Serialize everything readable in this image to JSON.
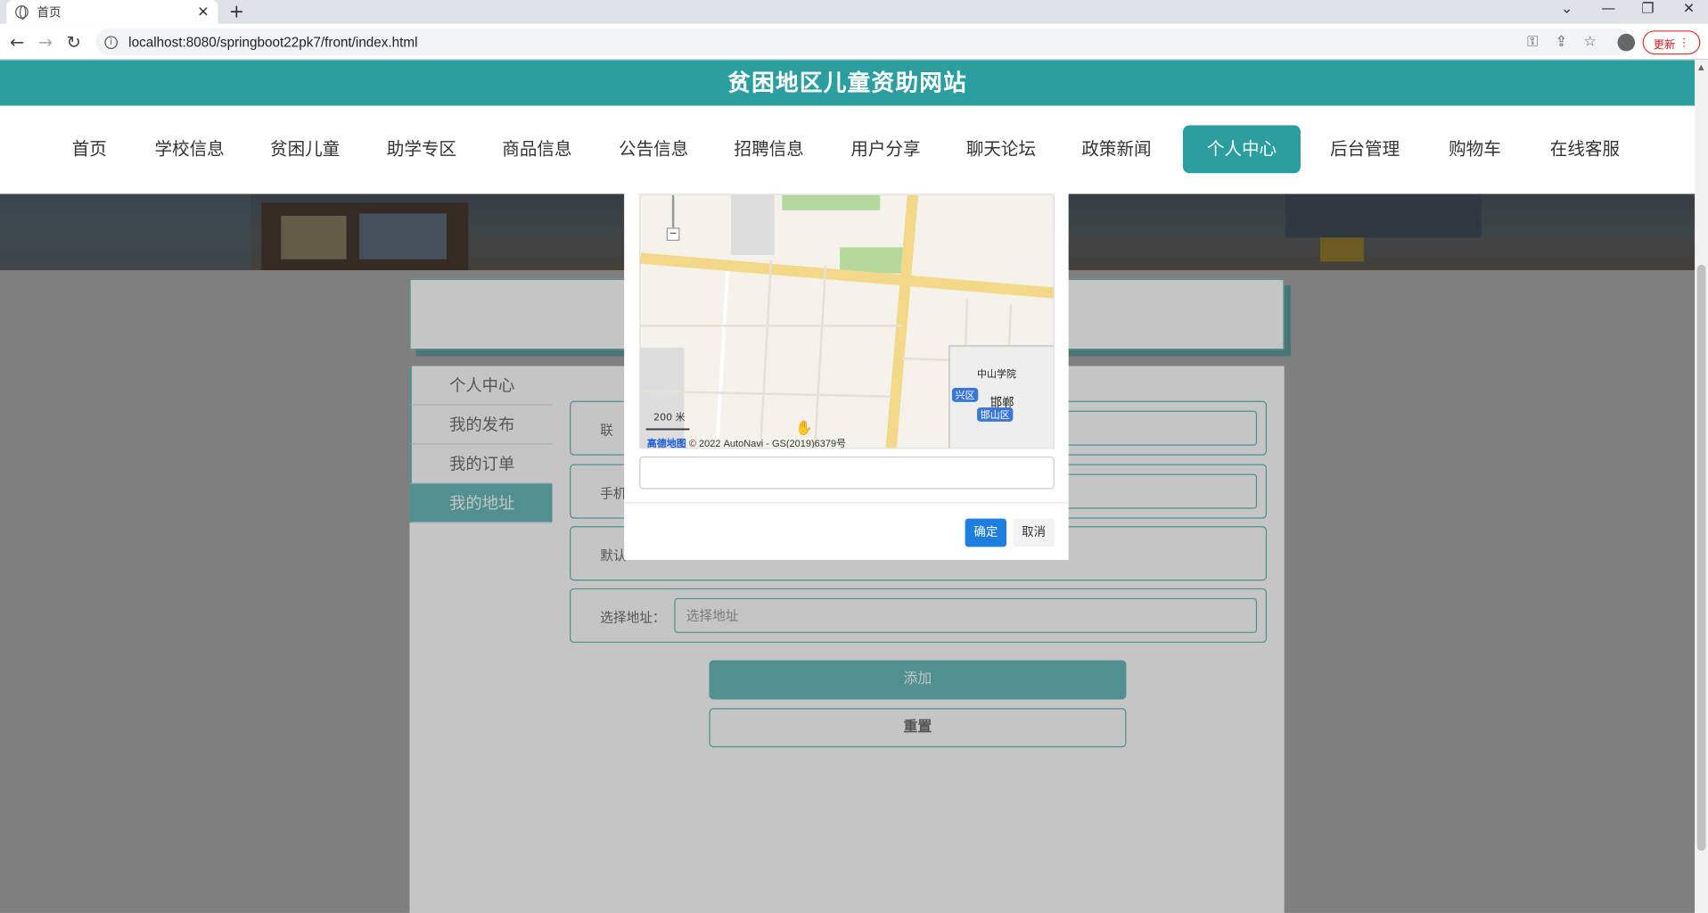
{
  "browser": {
    "tab_title": "首页",
    "url": "localhost:8080/springboot22pk7/front/index.html",
    "update_label": "更新"
  },
  "site": {
    "title": "贫困地区儿童资助网站"
  },
  "nav": {
    "items": [
      "首页",
      "学校信息",
      "贫困儿童",
      "助学专区",
      "商品信息",
      "公告信息",
      "招聘信息",
      "用户分享",
      "聊天论坛",
      "政策新闻",
      "个人中心",
      "后台管理",
      "购物车",
      "在线客服"
    ],
    "active": "个人中心"
  },
  "sidebar": {
    "items": [
      "个人中心",
      "我的发布",
      "我的订单",
      "我的地址"
    ],
    "active": "我的地址"
  },
  "form": {
    "fields": [
      {
        "label": "联",
        "value": ""
      },
      {
        "label": "手机",
        "value": ""
      },
      {
        "label": "默认",
        "value": ""
      },
      {
        "label": "选择地址：",
        "value": "",
        "placeholder": "选择地址"
      }
    ],
    "add_label": "添加",
    "reset_label": "重置"
  },
  "modal": {
    "map": {
      "scale_label": "200 米",
      "provider": "高德地图",
      "copyright": "© 2022 AutoNavi - GS(2019)6379号",
      "minimap_labels": [
        "中山学院",
        "邯郸",
        "兴区",
        "邯山区"
      ]
    },
    "ok_label": "确定",
    "cancel_label": "取消"
  },
  "colors": {
    "brand": "#2b9ea0",
    "primary_button": "#1e7fe0"
  }
}
